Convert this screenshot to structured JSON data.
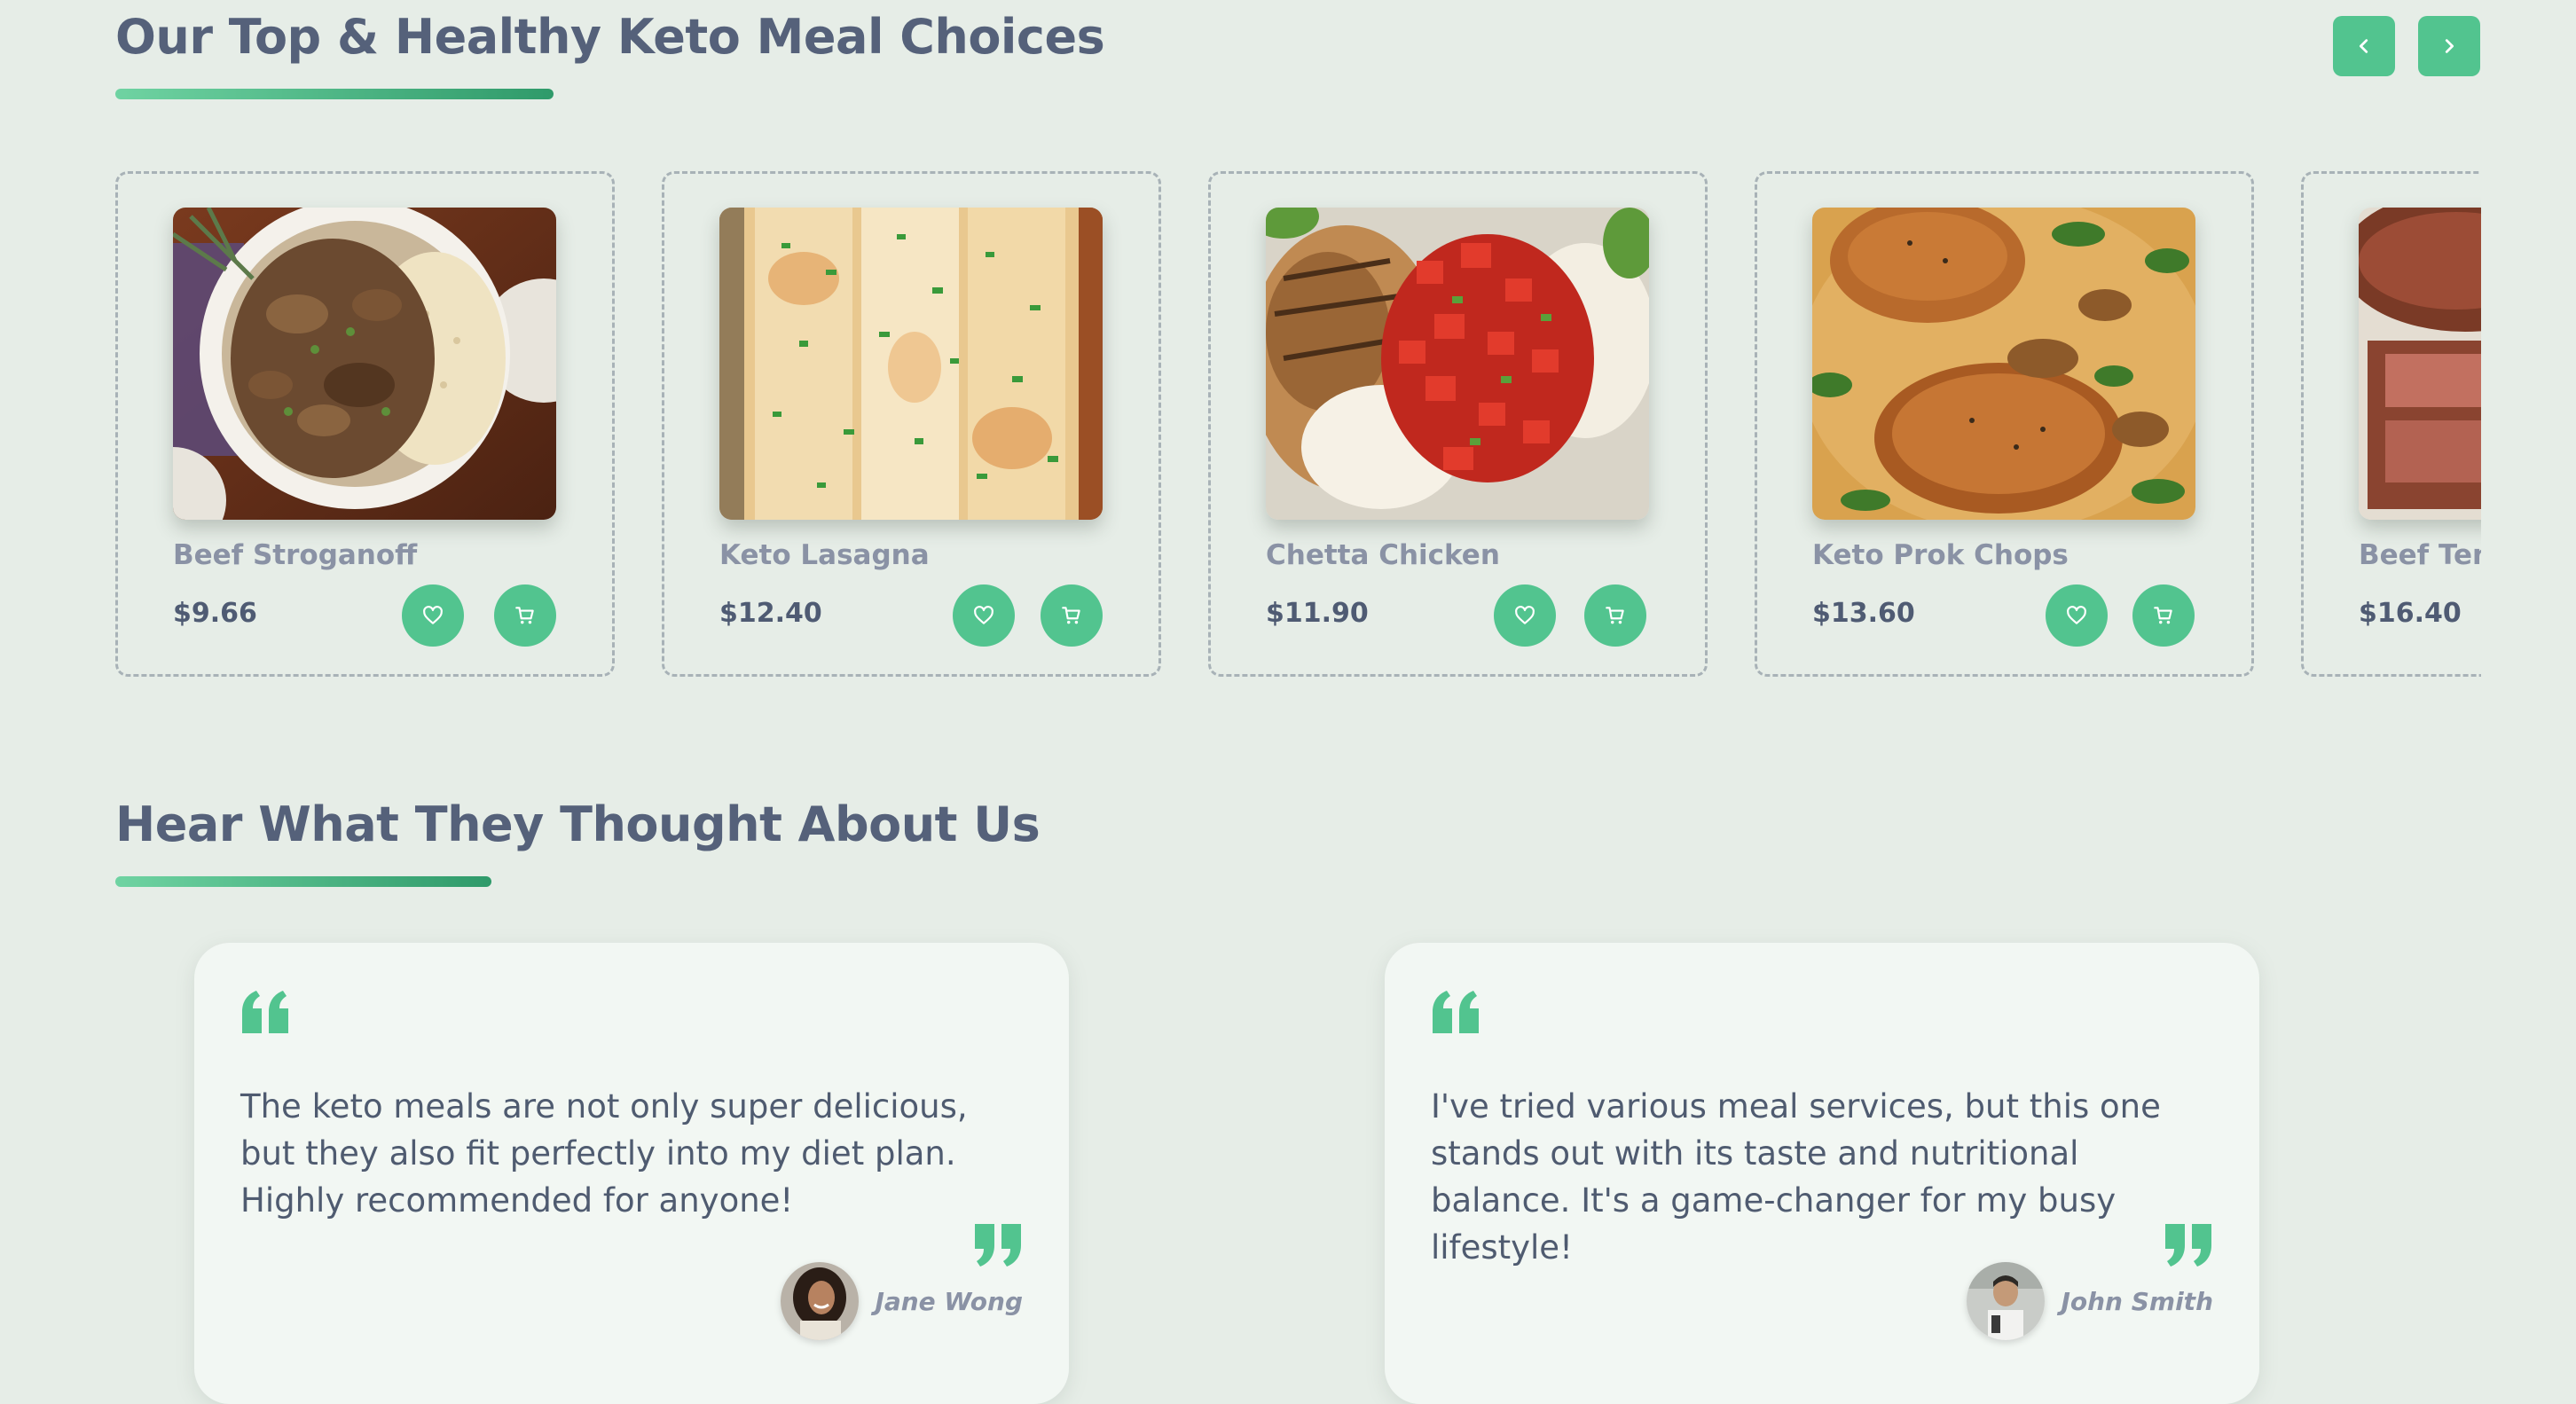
{
  "meals_section": {
    "title": "Our Top & Healthy Keto Meal Choices",
    "prev_icon": "chevron-left-icon",
    "next_icon": "chevron-right-icon",
    "accent_color": "#52c48f",
    "items": [
      {
        "name": "Beef Stroganoff",
        "price": "$9.66"
      },
      {
        "name": "Keto Lasagna",
        "price": "$12.40"
      },
      {
        "name": "Chetta Chicken",
        "price": "$11.90"
      },
      {
        "name": "Keto Prok Chops",
        "price": "$13.60"
      },
      {
        "name": "Beef Tenderloin",
        "price": "$16.40"
      }
    ],
    "favorite_icon": "heart-icon",
    "cart_icon": "cart-icon"
  },
  "testimonials_section": {
    "title": "Hear What They Thought About Us",
    "items": [
      {
        "text": "The keto meals are not only super delicious, but they also fit perfectly into my diet plan. Highly recommended for anyone!",
        "author": "Jane Wong"
      },
      {
        "text": "I've tried various meal services, but this one stands out with its taste and nutritional balance. It's a game-changer for my busy lifestyle!",
        "author": "John Smith"
      }
    ]
  }
}
